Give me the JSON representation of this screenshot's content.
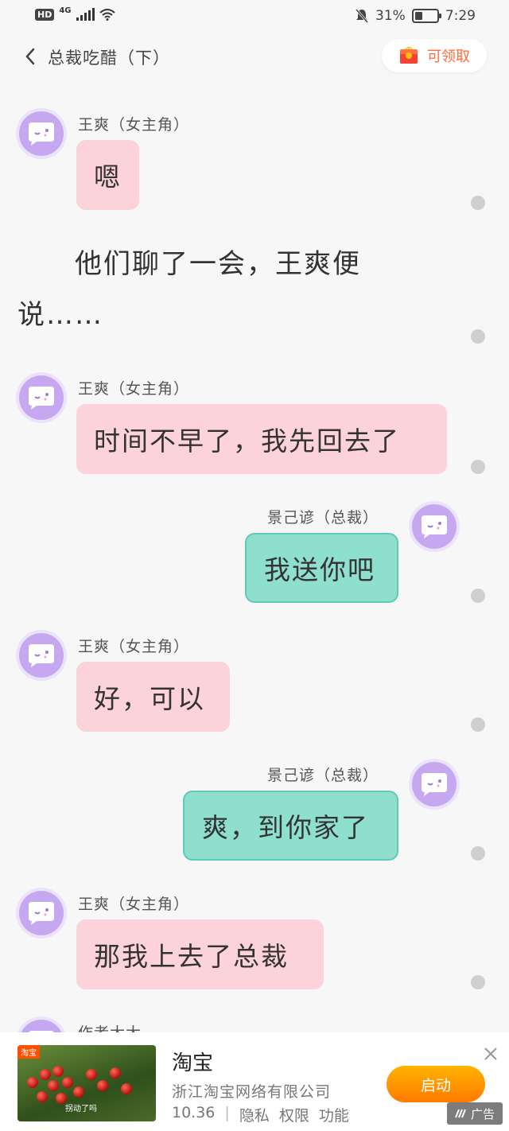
{
  "status_bar": {
    "hd": "HD",
    "network": "4G",
    "battery_percent": "31%",
    "time": "7:29"
  },
  "header": {
    "title": "总裁吃醋（下）",
    "claim_label": "可领取"
  },
  "messages": [
    {
      "side": "left",
      "name": "王爽（女主角）",
      "text": "嗯"
    },
    {
      "narration": [
        "他们聊了一会，王爽便",
        "说……"
      ]
    },
    {
      "side": "left",
      "name": "王爽（女主角）",
      "text": "时间不早了，我先回去了"
    },
    {
      "side": "right",
      "name": "景己谚（总裁）",
      "text": "我送你吧"
    },
    {
      "side": "left",
      "name": "王爽（女主角）",
      "text": "好，可以"
    },
    {
      "side": "right",
      "name": "景己谚（总裁）",
      "text": "爽，到你家了"
    },
    {
      "side": "left",
      "name": "王爽（女主角）",
      "text": "那我上去了总裁"
    },
    {
      "side": "left",
      "name": "作者大大",
      "text": ""
    }
  ],
  "ad": {
    "thumb_tag": "淘宝",
    "thumb_caption": "拐动了吗",
    "title": "淘宝",
    "company": "浙江淘宝网络有限公司",
    "version": "10.36",
    "links": [
      "隐私",
      "权限",
      "功能"
    ],
    "button": "启动",
    "label": "广告"
  },
  "colors": {
    "left_bubble": "#fcd3db",
    "right_bubble": "#8fdfcf",
    "avatar": "#c5a8f0",
    "claim_text": "#ff6b3d",
    "ad_button": "#ff9500"
  }
}
